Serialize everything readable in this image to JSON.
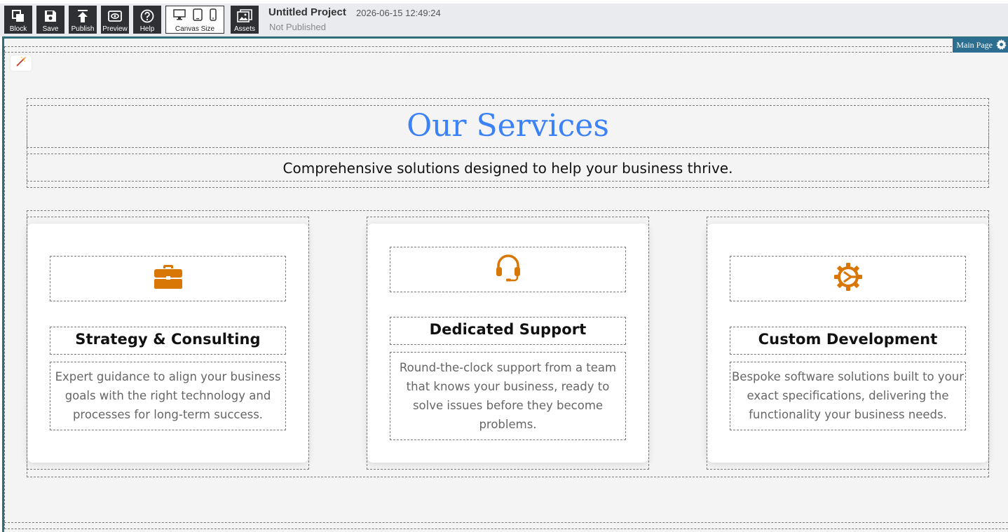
{
  "toolbar": {
    "block_label": "Block",
    "save_label": "Save",
    "publish_label": "Publish",
    "preview_label": "Preview",
    "help_label": "Help",
    "canvas_size_label": "Canvas Size",
    "assets_label": "Assets"
  },
  "project": {
    "title": "Untitled Project",
    "timestamp": "2026-06-15 12:49:24",
    "status": "Not Published"
  },
  "canvas": {
    "page_tag": "Main Page"
  },
  "services": {
    "heading": "Our Services",
    "subheading": "Comprehensive solutions designed to help your business thrive.",
    "cards": [
      {
        "icon": "briefcase-icon",
        "title": "Strategy & Consulting",
        "text": "Expert guidance to align your business goals with the right technology and processes for long-term success."
      },
      {
        "icon": "headset-icon",
        "title": "Dedicated Support",
        "text": "Round-the-clock support from a team that knows your business, ready to solve issues before they become problems."
      },
      {
        "icon": "gear-code-icon",
        "title": "Custom Development",
        "text": "Bespoke software solutions built to your exact specifications, delivering the functionality your business needs."
      }
    ]
  },
  "colors": {
    "accent_blue": "#3b82f6",
    "icon_orange": "#d97706",
    "toolbar_dark": "#2f3033",
    "page_tag": "#2b6e8f"
  }
}
